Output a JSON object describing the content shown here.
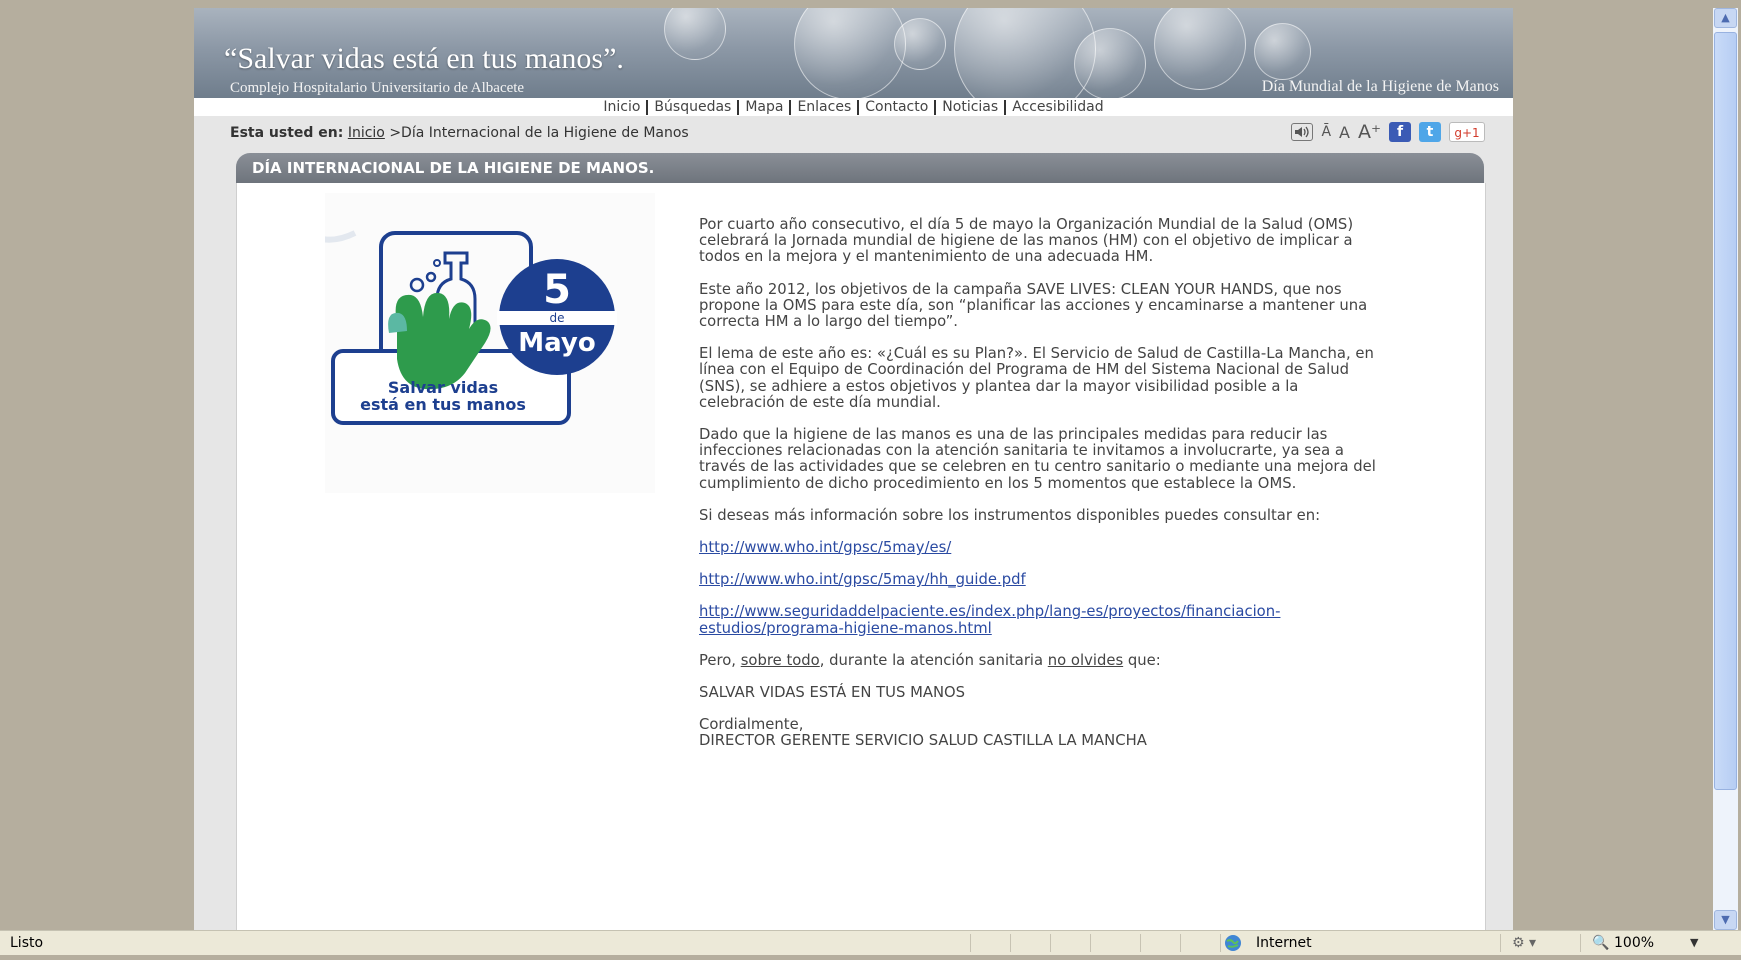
{
  "header": {
    "slogan": "“Salvar vidas está en tus manos”.",
    "hospital": "Complejo Hospitalario Universitario de Albacete",
    "day": "Día Mundial de la Higiene de Manos"
  },
  "nav": [
    "Inicio",
    "Búsquedas",
    "Mapa",
    "Enlaces",
    "Contacto",
    "Noticias",
    "Accesibilidad"
  ],
  "breadcrumb": {
    "label": "Esta usted en:",
    "home": "Inicio",
    "separator": ">",
    "current": "Día Internacional de la Higiene de Manos"
  },
  "tools": {
    "font_small": "Ā",
    "font_normal": "A",
    "font_large": "A⁺",
    "facebook": "f",
    "twitter": "t",
    "gplus": "g+1"
  },
  "title": "DÍA INTERNACIONAL DE LA HIGIENE DE MANOS.",
  "logo": {
    "day_number": "5",
    "de": "de",
    "month": "Mayo",
    "line1": "Salvar vidas",
    "line2": "está en tus manos"
  },
  "body": {
    "p1": "Por cuarto año consecutivo, el día 5 de mayo la Organización Mundial de la Salud (OMS) celebrará la Jornada mundial de higiene de las manos (HM) con el objetivo de implicar a todos en la mejora y el mantenimiento de una adecuada HM.",
    "p2": "Este año 2012, los objetivos de la campaña SAVE LIVES: CLEAN YOUR HANDS, que nos propone la OMS para este día, son “planificar las acciones y encaminarse a mantener una correcta HM a lo largo del tiempo”.",
    "p3": "El lema de este año es: «¿Cuál es su Plan?». El Servicio de Salud de Castilla-La Mancha, en línea con el Equipo de Coordinación del Programa de HM del Sistema Nacional de Salud (SNS), se adhiere a estos objetivos y plantea dar la mayor visibilidad posible a la celebración de este día mundial.",
    "p4": "Dado que la higiene de las manos es una de las principales medidas para reducir las infecciones relacionadas con la atención sanitaria te invitamos a involucrarte, ya sea a través de las actividades que se celebren en tu centro sanitario o mediante una mejora del cumplimiento de dicho procedimiento en los 5 momentos que establece la OMS.",
    "p5": "Si deseas más información sobre los instrumentos disponibles puedes consultar en:",
    "link1": "http://www.who.int/gpsc/5may/es/",
    "link2": "http://www.who.int/gpsc/5may/hh_guide.pdf",
    "link3": "http://www.seguridaddelpaciente.es/index.php/lang-es/proyectos/financiacion-estudios/programa-higiene-manos.html",
    "p6_pre": "Pero, ",
    "p6_u1": "sobre todo",
    "p6_mid": ", durante la atención sanitaria ",
    "p6_u2": "no olvides",
    "p6_post": " que:",
    "p7": "SALVAR VIDAS ESTÁ EN TUS MANOS",
    "sign1": "Cordialmente,",
    "sign2": "DIRECTOR GERENTE SERVICIO SALUD CASTILLA LA MANCHA"
  },
  "status": {
    "left": "Listo",
    "zone": "Internet",
    "zoom": "100%"
  },
  "colors": {
    "logo_blue": "#1d3f8f",
    "logo_green": "#2e9b4c",
    "title_bar": "#7a8088",
    "link": "#2a4aa2"
  }
}
